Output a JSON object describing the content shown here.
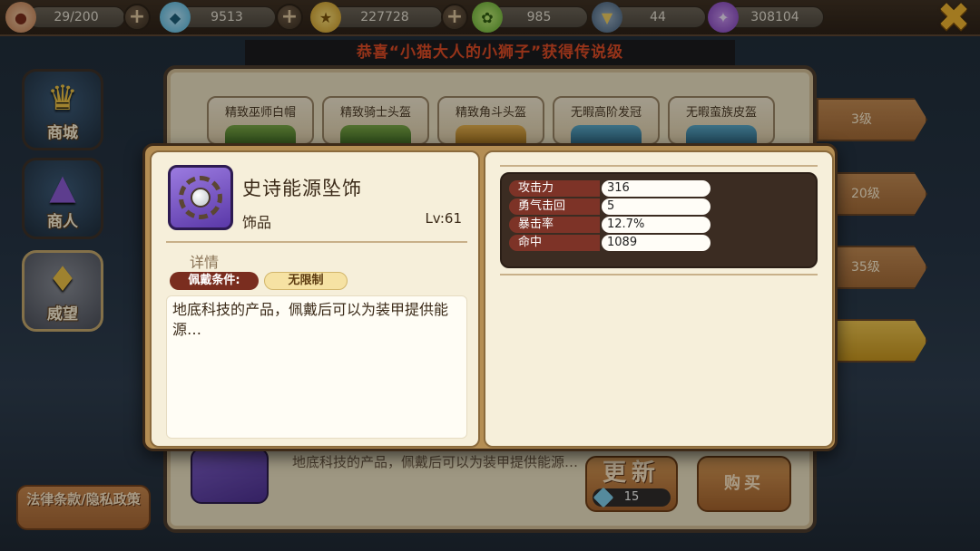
{
  "topbar": {
    "stamina": "29/200",
    "diamonds": "9513",
    "gold": "227728",
    "candy": "985",
    "badge": "44",
    "stars": "308104",
    "icons": [
      "meat-icon",
      "diamond-icon",
      "gold-coin-icon",
      "lollipop-icon",
      "rank-badge-icon",
      "purple-star-icon",
      "plus-icon",
      "close-icon"
    ]
  },
  "announcement": "恭喜“小猫大人的小狮子”获得传说级",
  "nav": {
    "shop": "商城",
    "merchant": "商人",
    "prestige": "威望"
  },
  "legal": "法律条款/隐私政策",
  "shop": {
    "slots": [
      "精致巫师白帽",
      "精致骑士头盔",
      "精致角斗头盔",
      "无暇高阶发冠",
      "无暇蛮族皮盔"
    ],
    "tiers": [
      "3级",
      "20级",
      "35级"
    ],
    "bottom_desc": "地底科技的产品，佩戴后可以为装甲提供能源…",
    "refresh_label": "更新",
    "refresh_cost": "15",
    "buy_label": "购买"
  },
  "item": {
    "name": "史诗能源坠饰",
    "type": "饰品",
    "level": "Lv:61",
    "detail_heading": "详情",
    "requirement_label": "佩戴条件:",
    "requirement_value": "无限制",
    "description": "地底科技的产品，佩戴后可以为装甲提供能源…",
    "stats": [
      {
        "name": "攻击力",
        "value": "316"
      },
      {
        "name": "勇气击回",
        "value": "5"
      },
      {
        "name": "暴击率",
        "value": "12.7%"
      },
      {
        "name": "命中",
        "value": "1089"
      }
    ]
  },
  "colors": {
    "panel_bg": "#f6efda",
    "stat_label_bg": "#7d3327",
    "accent_gold": "#f3b62e",
    "announce_red": "#e04a24"
  }
}
